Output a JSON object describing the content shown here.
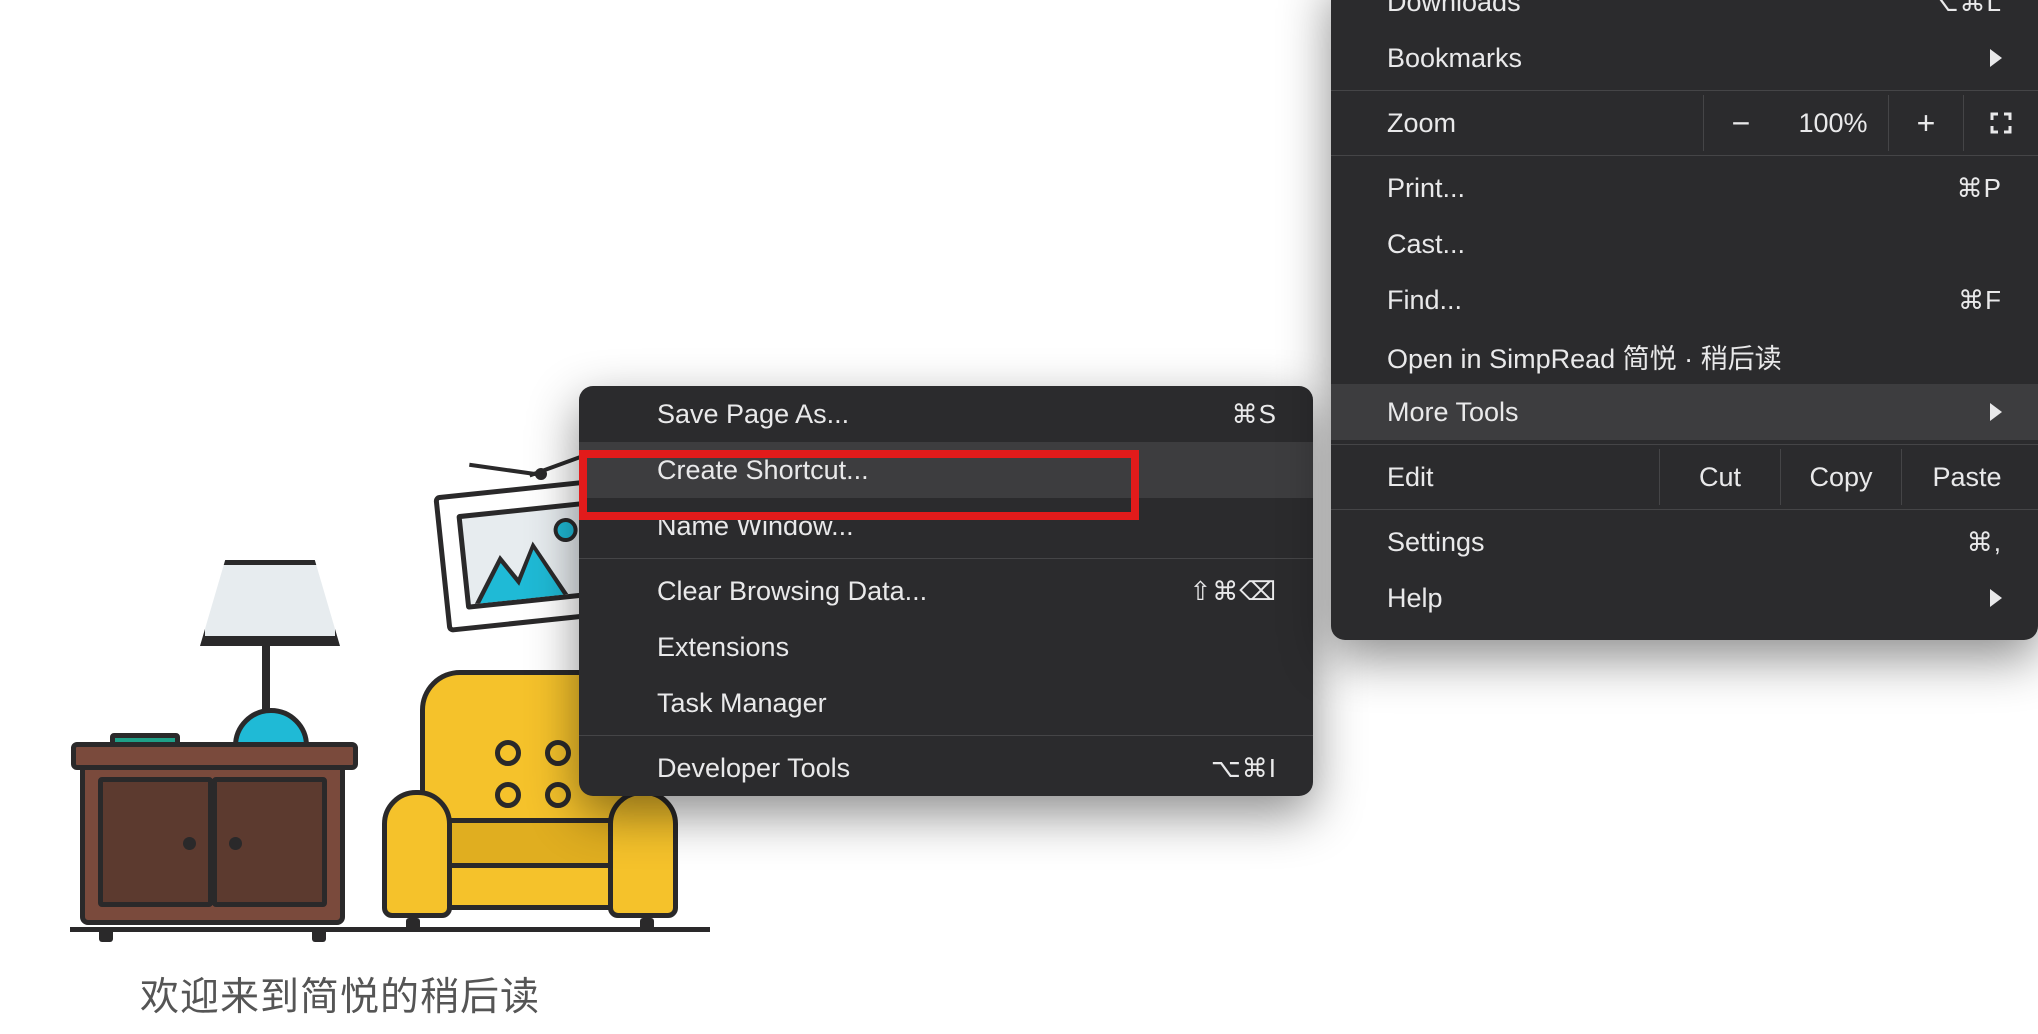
{
  "illustration": {
    "caption": "欢迎来到简悦的稍后读"
  },
  "submenu": {
    "items": [
      {
        "label": "Save Page As...",
        "shortcut": "⌘S"
      },
      {
        "label": "Create Shortcut...",
        "highlighted": true
      },
      {
        "label": "Name Window..."
      }
    ],
    "group2": [
      {
        "label": "Clear Browsing Data...",
        "shortcut": "⇧⌘⌫"
      },
      {
        "label": "Extensions"
      },
      {
        "label": "Task Manager"
      }
    ],
    "group3": [
      {
        "label": "Developer Tools",
        "shortcut": "⌥⌘I"
      }
    ]
  },
  "mainmenu": {
    "downloads": {
      "label": "Downloads",
      "shortcut": "⌥⌘L"
    },
    "bookmarks": {
      "label": "Bookmarks"
    },
    "zoom": {
      "label": "Zoom",
      "level": "100%"
    },
    "print": {
      "label": "Print...",
      "shortcut": "⌘P"
    },
    "cast": {
      "label": "Cast..."
    },
    "find": {
      "label": "Find...",
      "shortcut": "⌘F"
    },
    "simpread": {
      "label": "Open in SimpRead 简悦 · 稍后读"
    },
    "moretools": {
      "label": "More Tools"
    },
    "edit": {
      "label": "Edit",
      "cut": "Cut",
      "copy": "Copy",
      "paste": "Paste"
    },
    "settings": {
      "label": "Settings",
      "shortcut": "⌘,"
    },
    "help": {
      "label": "Help"
    }
  }
}
